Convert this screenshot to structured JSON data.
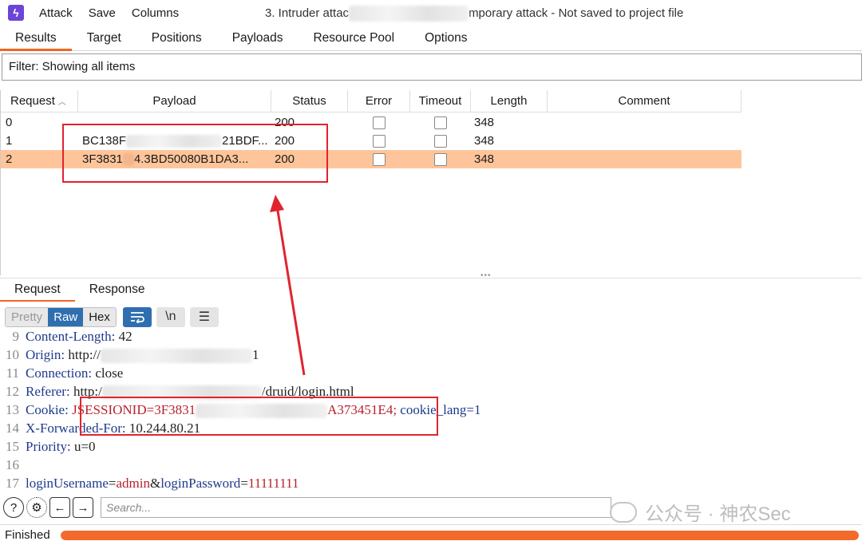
{
  "menu": {
    "app_icon": "burp-lightning-icon",
    "items": [
      "Attack",
      "Save",
      "Columns"
    ],
    "window_title_prefix": "3. Intruder attac",
    "window_title_suffix": "mporary attack - Not saved to project file"
  },
  "tabs": [
    "Results",
    "Target",
    "Positions",
    "Payloads",
    "Resource Pool",
    "Options"
  ],
  "active_tab": "Results",
  "filter": {
    "label": "Filter: Showing all items"
  },
  "table": {
    "headers": [
      "Request",
      "Payload",
      "Status",
      "Error",
      "Timeout",
      "Length",
      "Comment"
    ],
    "rows": [
      {
        "request": "0",
        "payload_start": "",
        "payload_end": "",
        "status": "200",
        "error": false,
        "timeout": false,
        "length": "348",
        "comment": "",
        "selected": false
      },
      {
        "request": "1",
        "payload_start": "BC138F",
        "payload_end": "21BDF...",
        "status": "200",
        "error": false,
        "timeout": false,
        "length": "348",
        "comment": "",
        "selected": false
      },
      {
        "request": "2",
        "payload_start": "3F3831",
        "payload_end": "4.3BD50080B1DA3...",
        "status": "200",
        "error": false,
        "timeout": false,
        "length": "348",
        "comment": "",
        "selected": true
      }
    ]
  },
  "rr_tabs": [
    "Request",
    "Response"
  ],
  "editor_toolbar": {
    "pretty": "Pretty",
    "raw": "Raw",
    "hex": "Hex",
    "wrap_icon": "wrap-icon",
    "newline_label": "\\n",
    "menu_icon": "hamburger-icon"
  },
  "request_lines": [
    {
      "n": "9",
      "key": "Content-Length",
      "val": "42"
    },
    {
      "n": "10",
      "key": "Origin",
      "val_a": "http://",
      "val_b": "1"
    },
    {
      "n": "11",
      "key": "Connection",
      "val": "close"
    },
    {
      "n": "12",
      "key": "Referer",
      "val_a": "http:/",
      "val_b": "/druid/login.html"
    },
    {
      "n": "13",
      "key": "Cookie",
      "val_a": "JSESSIONID=3F3831",
      "val_b": "A373451E4;",
      "val_c": "cookie_lang=1"
    },
    {
      "n": "14",
      "key": "X-Forwarded-For",
      "val": "10.244.80.21"
    },
    {
      "n": "15",
      "key": "Priority",
      "val": "u=0"
    },
    {
      "n": "16"
    },
    {
      "n": "17",
      "p1": "loginUsername",
      "v1": "admin",
      "p2": "loginPassword",
      "v2": "11111111"
    }
  ],
  "search": {
    "placeholder": "Search..."
  },
  "watermark": "公众号 · 神农Sec",
  "status": {
    "text": "Finished",
    "progress": 1.0
  }
}
